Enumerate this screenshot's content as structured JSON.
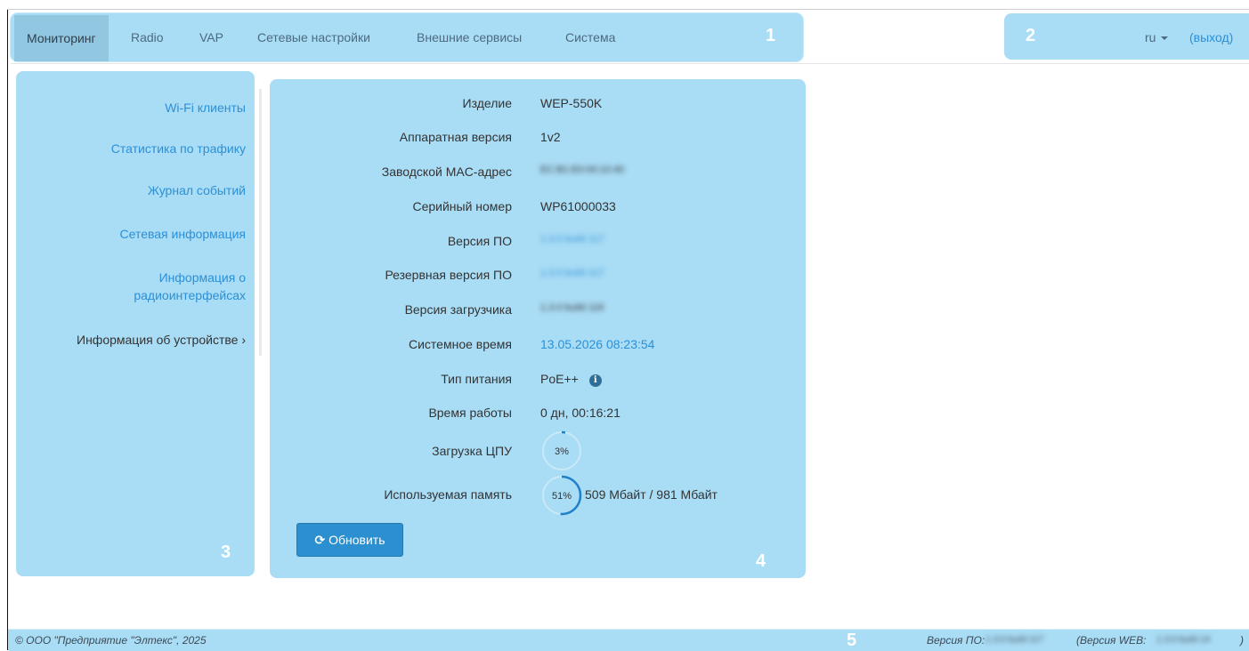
{
  "nav": {
    "items": [
      {
        "label": "Мониторинг"
      },
      {
        "label": "Radio"
      },
      {
        "label": "VAP"
      },
      {
        "label": "Сетевые настройки"
      },
      {
        "label": "Внешние сервисы"
      },
      {
        "label": "Система"
      }
    ],
    "region": "1"
  },
  "nav_right": {
    "region": "2",
    "lang": "ru",
    "logout": "(выход)"
  },
  "sidebar": {
    "region": "3",
    "items": [
      {
        "label": "Wi-Fi клиенты"
      },
      {
        "label": "Статистика по трафику"
      },
      {
        "label": "Журнал событий"
      },
      {
        "label": "Сетевая информация"
      },
      {
        "label_line1": "Информация о",
        "label_line2": "радиоинтерфейсах"
      },
      {
        "label": "Информация об устройстве"
      }
    ]
  },
  "device": {
    "region": "4",
    "rows": [
      {
        "label": "Изделие",
        "value": "WEP-550K"
      },
      {
        "label": "Аппаратная версия",
        "value": "1v2"
      },
      {
        "label": "Заводской MAC-адрес",
        "value": "EC:B1:E0:00:10:40"
      },
      {
        "label": "Серийный номер",
        "value": "WP61000033"
      },
      {
        "label": "Версия ПО",
        "value": "1.3.0 build 117"
      },
      {
        "label": "Резервная версия ПО",
        "value": "1.3.0 build 117"
      },
      {
        "label": "Версия загрузчика",
        "value": "1.3.0 build 116"
      },
      {
        "label": "Системное время",
        "value": "13.05.2026 08:23:54"
      },
      {
        "label": "Тип питания",
        "value": "PoE++"
      },
      {
        "label": "Время работы",
        "value": "0 дн, 00:16:21"
      },
      {
        "label": "Загрузка ЦПУ",
        "value": "3%",
        "percent": 3
      },
      {
        "label": "Используемая память",
        "value": "51%",
        "percent": 51,
        "detail": "509 Мбайт / 981 Мбайт"
      }
    ],
    "refresh_label": "Обновить"
  },
  "footer": {
    "copyright": "© ООО \"Предприятие \"Элтекс\", 2025",
    "region": "5",
    "fw_label": "Версия ПО:",
    "fw_value": "1.3.0 build 117",
    "web_label": "(Версия WEB:",
    "web_value": "1.3.0 build 14",
    "web_close": ")"
  },
  "colors": {
    "panel": "#a9dcf5",
    "accent": "#2c90d6",
    "button": "#2c8fd0",
    "gauge": "#1f7fc8"
  }
}
